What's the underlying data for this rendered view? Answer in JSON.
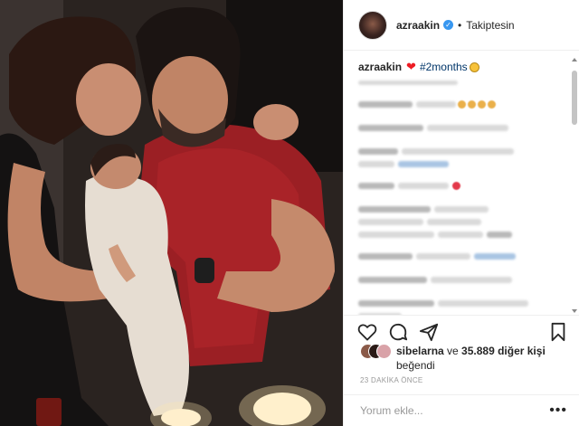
{
  "header": {
    "username": "azraakin",
    "verified_glyph": "✓",
    "separator": "•",
    "follow_label": "Takiptesin"
  },
  "caption": {
    "username": "azraakin",
    "heart": "❤",
    "hashtag": "#2months"
  },
  "actions": {
    "icons": [
      "heart-outline-icon",
      "comment-icon",
      "share-icon",
      "bookmark-icon"
    ]
  },
  "likes": {
    "first_user": "sibelarna",
    "conjunction": " ve ",
    "others": "35.889 diğer kişi",
    "suffix": "beğendi"
  },
  "timestamp": "23 DAKİKA ÖNCE",
  "comment_box": {
    "placeholder": "Yorum ekle...",
    "more_label": "•••"
  },
  "colors": {
    "link": "#003569",
    "verified": "#3897f0",
    "heart": "#ed1c24",
    "muted": "#999999"
  }
}
